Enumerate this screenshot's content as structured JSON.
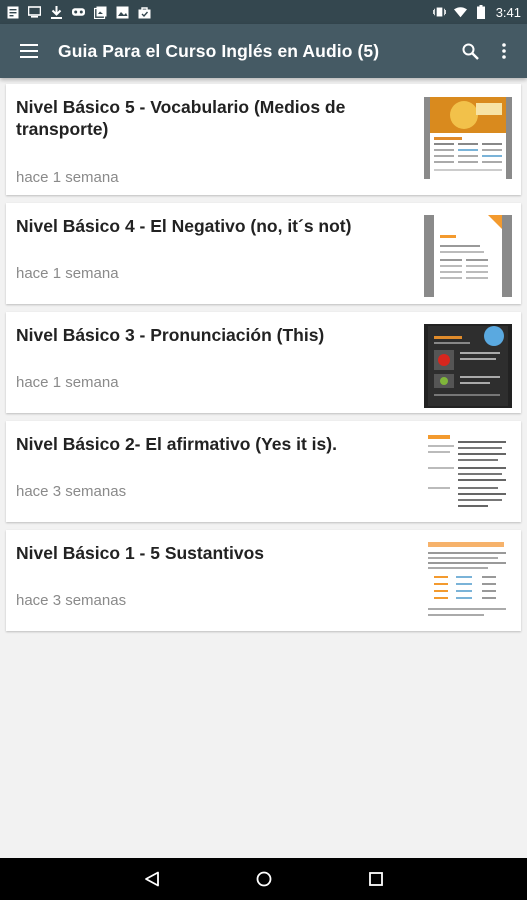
{
  "status_bar": {
    "time": "3:41",
    "left_icons": [
      "document-icon",
      "sim-icon",
      "download-icon",
      "vr-icon",
      "gallery-icon",
      "photo-icon",
      "bag-icon"
    ],
    "right_icons": [
      "vibrate-icon",
      "wifi-icon",
      "battery-icon"
    ]
  },
  "app_bar": {
    "title": "Guia Para el Curso Inglés en Audio (5)",
    "menu_icon": "hamburger-icon",
    "actions": [
      "search-icon",
      "overflow-icon"
    ]
  },
  "items": [
    {
      "title": "Nivel Básico 5 - Vocabulario (Medios de transporte)",
      "time": "hace 1 semana"
    },
    {
      "title": "Nivel Básico 4 - El Negativo (no, it´s not)",
      "time": "hace 1 semana"
    },
    {
      "title": "Nivel Básico 3 - Pronunciación (This)",
      "time": "hace 1 semana"
    },
    {
      "title": "Nivel Básico 2- El afirmativo (Yes it is).",
      "time": "hace 3 semanas"
    },
    {
      "title": "Nivel Básico 1 - 5 Sustantivos",
      "time": "hace 3 semanas"
    }
  ],
  "nav_bar": [
    "back-icon",
    "home-icon",
    "recents-icon"
  ],
  "colors": {
    "status_bar": "#34474f",
    "app_bar": "#455a64",
    "background": "#f2f2f2",
    "card": "#ffffff",
    "accent_orange": "#f39a2e"
  }
}
